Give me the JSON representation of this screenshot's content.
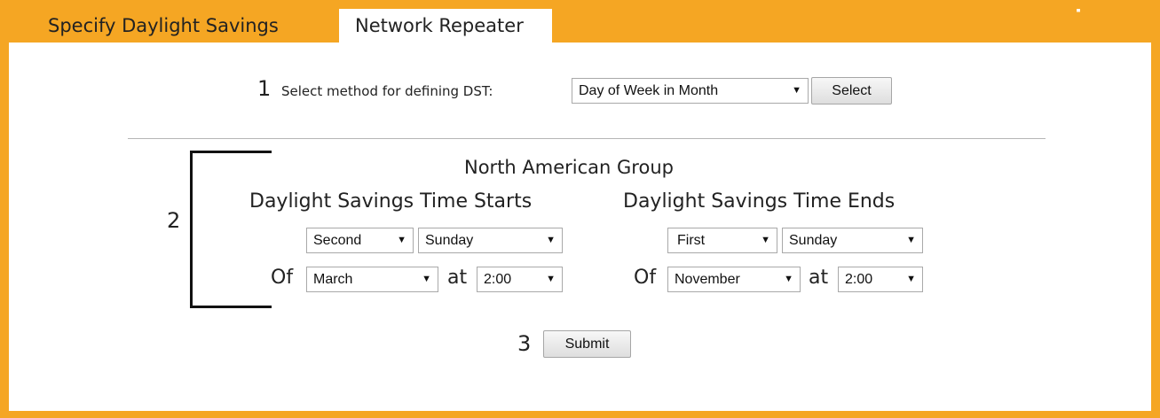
{
  "header_ghost": "Network Repeater",
  "tabs": {
    "dst": "Specify Daylight Savings",
    "network": "Network Repeater"
  },
  "step1": {
    "number": "1",
    "label": "Select method for defining DST:",
    "method_selected": "Day of Week in Month",
    "select_button": "Select"
  },
  "step2": {
    "number": "2",
    "group_title": "North American Group",
    "starts": {
      "title": "Daylight Savings Time Starts",
      "week": "Second",
      "day": "Sunday",
      "of_label": "Of",
      "month": "March",
      "at_label": "at",
      "time": "2:00"
    },
    "ends": {
      "title": "Daylight Savings Time Ends",
      "week": "First",
      "day": "Sunday",
      "of_label": "Of",
      "month": "November",
      "at_label": "at",
      "time": "2:00"
    }
  },
  "step3": {
    "number": "3",
    "submit_button": "Submit"
  },
  "icons": {
    "dropdown_arrow": "▼"
  },
  "colors": {
    "accent_orange": "#f5a623",
    "background": "#ffffff"
  }
}
